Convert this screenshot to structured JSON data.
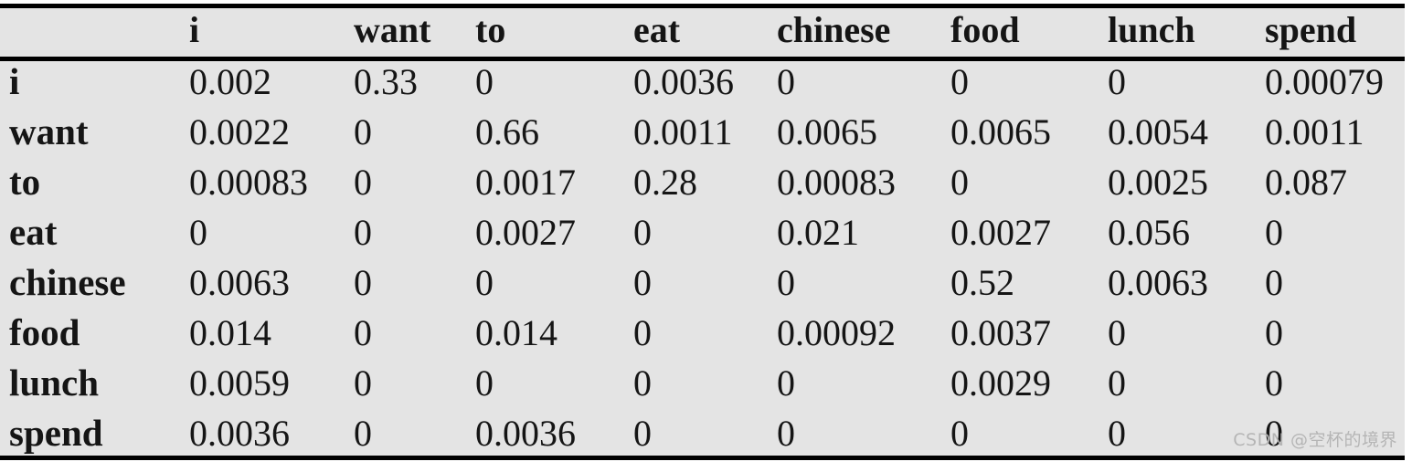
{
  "table": {
    "corner_label": "",
    "columns": [
      "i",
      "want",
      "to",
      "eat",
      "chinese",
      "food",
      "lunch",
      "spend"
    ],
    "rows": [
      {
        "label": "i",
        "values": [
          "0.002",
          "0.33",
          "0",
          "0.0036",
          "0",
          "0",
          "0",
          "0.00079"
        ]
      },
      {
        "label": "want",
        "values": [
          "0.0022",
          "0",
          "0.66",
          "0.0011",
          "0.0065",
          "0.0065",
          "0.0054",
          "0.0011"
        ]
      },
      {
        "label": "to",
        "values": [
          "0.00083",
          "0",
          "0.0017",
          "0.28",
          "0.00083",
          "0",
          "0.0025",
          "0.087"
        ]
      },
      {
        "label": "eat",
        "values": [
          "0",
          "0",
          "0.0027",
          "0",
          "0.021",
          "0.0027",
          "0.056",
          "0"
        ]
      },
      {
        "label": "chinese",
        "values": [
          "0.0063",
          "0",
          "0",
          "0",
          "0",
          "0.52",
          "0.0063",
          "0"
        ]
      },
      {
        "label": "food",
        "values": [
          "0.014",
          "0",
          "0.014",
          "0",
          "0.00092",
          "0.0037",
          "0",
          "0"
        ]
      },
      {
        "label": "lunch",
        "values": [
          "0.0059",
          "0",
          "0",
          "0",
          "0",
          "0.0029",
          "0",
          "0"
        ]
      },
      {
        "label": "spend",
        "values": [
          "0.0036",
          "0",
          "0.0036",
          "0",
          "0",
          "0",
          "0",
          "0"
        ]
      }
    ]
  },
  "watermark": {
    "text": "CSDN @空杯的境界"
  },
  "colors": {
    "background": "#e4e4e4",
    "page": "#ffffff",
    "text": "#151515",
    "zero_text": "#8d8d8d",
    "rule": "#000000",
    "watermark": "#b3b3b3"
  },
  "chart_data": {
    "type": "table",
    "title": "",
    "categories": [
      "i",
      "want",
      "to",
      "eat",
      "chinese",
      "food",
      "lunch",
      "spend"
    ],
    "row_labels": [
      "i",
      "want",
      "to",
      "eat",
      "chinese",
      "food",
      "lunch",
      "spend"
    ],
    "series": [
      {
        "name": "i",
        "values": [
          0.002,
          0.33,
          0,
          0.0036,
          0,
          0,
          0,
          0.00079
        ]
      },
      {
        "name": "want",
        "values": [
          0.0022,
          0,
          0.66,
          0.0011,
          0.0065,
          0.0065,
          0.0054,
          0.0011
        ]
      },
      {
        "name": "to",
        "values": [
          0.00083,
          0,
          0.0017,
          0.28,
          0.00083,
          0,
          0.0025,
          0.087
        ]
      },
      {
        "name": "eat",
        "values": [
          0,
          0,
          0.0027,
          0,
          0.021,
          0.0027,
          0.056,
          0
        ]
      },
      {
        "name": "chinese",
        "values": [
          0.0063,
          0,
          0,
          0,
          0,
          0.52,
          0.0063,
          0
        ]
      },
      {
        "name": "food",
        "values": [
          0.014,
          0,
          0.014,
          0,
          0.00092,
          0.0037,
          0,
          0
        ]
      },
      {
        "name": "lunch",
        "values": [
          0.0059,
          0,
          0,
          0,
          0,
          0.0029,
          0,
          0
        ]
      },
      {
        "name": "spend",
        "values": [
          0.0036,
          0,
          0.0036,
          0,
          0,
          0,
          0,
          0
        ]
      }
    ],
    "xlabel": "",
    "ylabel": "",
    "grid": false,
    "legend": "none"
  }
}
